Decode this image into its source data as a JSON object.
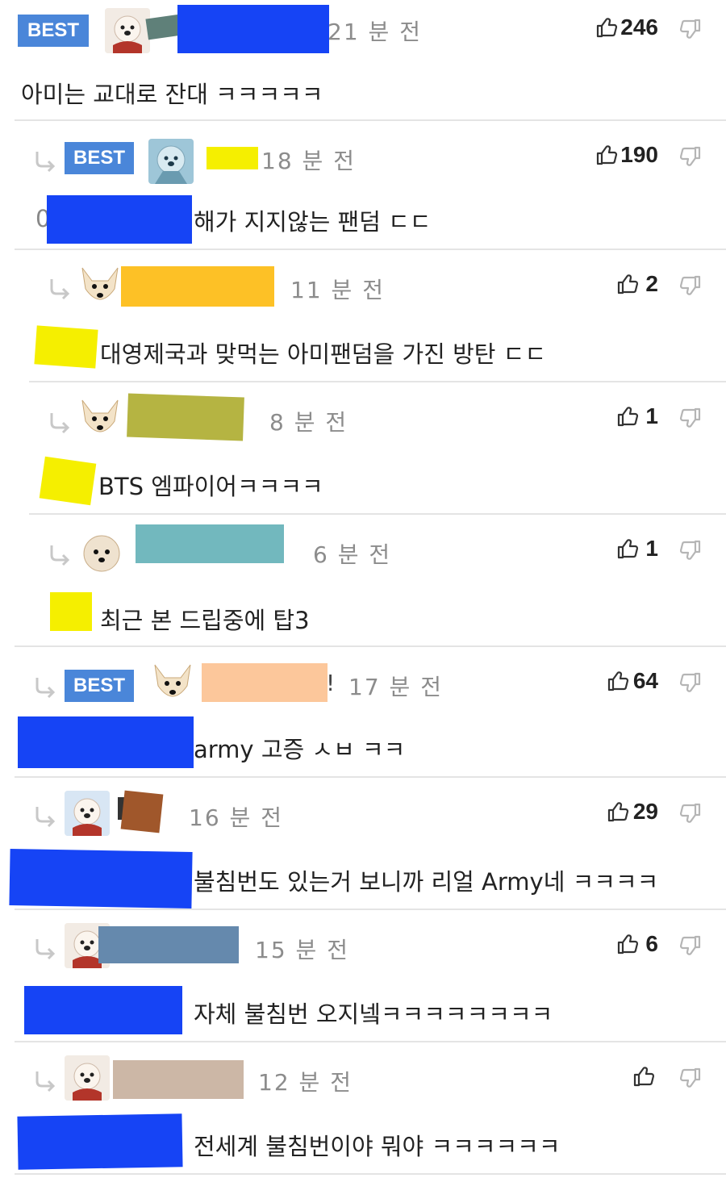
{
  "comments": [
    {
      "best": "BEST",
      "time": "21 분 전",
      "likes": "246",
      "text": "아미는 교대로 잔대 ㅋㅋㅋㅋㅋ",
      "reply": false,
      "avatar": "dog-bandana"
    },
    {
      "best": "BEST",
      "time": "18 분 전",
      "likes": "190",
      "prefix": "0",
      "text": "해가 지지않는 팬덤 ㄷㄷ",
      "reply": true,
      "avatar": "dog-blue"
    },
    {
      "time": "11 분 전",
      "likes": "2",
      "text": "대영제국과 맞먹는 아미팬덤을 가진 방탄 ㄷㄷ",
      "reply": true,
      "avatar": "chihuahua"
    },
    {
      "time": "8 분 전",
      "likes": "1",
      "text": "BTS 엠파이어ㅋㅋㅋㅋ",
      "reply": true,
      "avatar": "chihuahua"
    },
    {
      "time": "6 분 전",
      "likes": "1",
      "text": "최근 본 드립중에 탑3",
      "reply": true,
      "avatar": "poodle"
    },
    {
      "best": "BEST",
      "time": "17 분 전",
      "nameTail": "!",
      "likes": "64",
      "text": "army 고증 ㅅㅂ ㅋㅋ",
      "reply": true,
      "avatar": "chihuahua"
    },
    {
      "time": "16 분 전",
      "likes": "29",
      "text": "불침번도 있는거 보니까 리얼 Army네 ㅋㅋㅋㅋ",
      "reply": true,
      "avatar": "dog-bandana"
    },
    {
      "time": "15 분 전",
      "likes": "6",
      "text": "자체 불침번 오지넼ㅋㅋㅋㅋㅋㅋㅋㅋ",
      "reply": true,
      "avatar": "dog-bandana"
    },
    {
      "time": "12 분 전",
      "likes": "",
      "text": "전세계 불침번이야 뭐야 ㅋㅋㅋㅋㅋㅋ",
      "reply": true,
      "avatar": "dog-bandana"
    }
  ],
  "colors": {
    "best_badge": "#4a86d9",
    "redact_blue": "#1644f5",
    "redact_yellow": "#f5ef00",
    "text": "#222222",
    "meta": "#8c8c8c"
  }
}
